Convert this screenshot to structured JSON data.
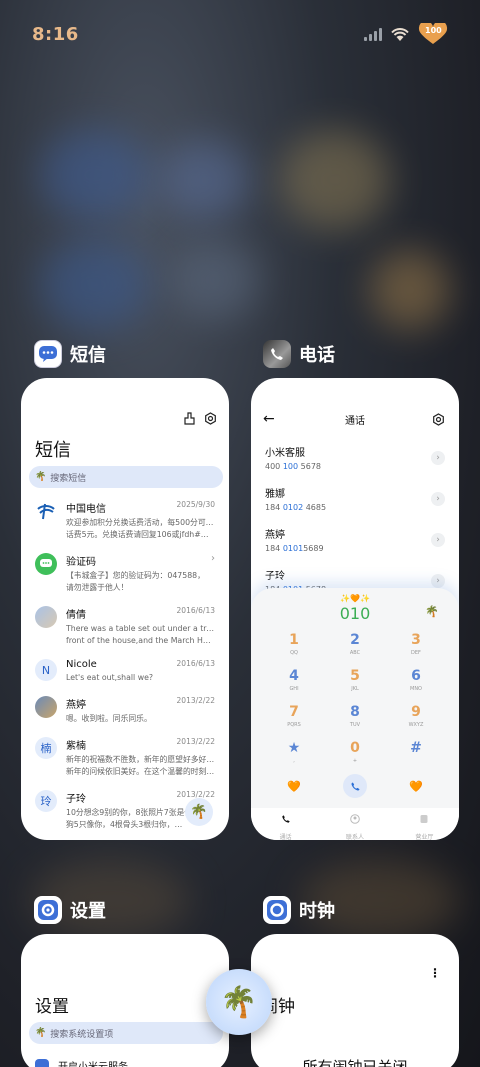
{
  "status_bar": {
    "time": "8:16",
    "battery": "100"
  },
  "colors": {
    "accent": "#2b6fd6",
    "digit_orange": "#e8a45a",
    "digit_blue": "#5b86d4",
    "search_bg": "#dfe8f9"
  },
  "sms_app": {
    "title": "短信",
    "screen_title": "短信",
    "search_placeholder": "搜索短信",
    "messages": [
      {
        "name": "中国电信",
        "date": "2025/9/30",
        "line1": "欢迎参加积分兑换话费活动，每500分可兑换",
        "line2": "话费5元。兑换话费请回复106或jfdh#话费…"
      },
      {
        "name": "验证码",
        "date": "",
        "line1": "【韦城盒子】您的验证码为：047588，",
        "line2": "请勿泄露于他人！"
      },
      {
        "name": "倩倩",
        "date": "2016/6/13",
        "line1": "There was a table set out under a tree in",
        "line2": "front of the house,and the March Hare an…"
      },
      {
        "name": "Nicole",
        "date": "2016/6/13",
        "line1": "Let's eat out,shall we?",
        "line2": ""
      },
      {
        "name": "燕婷",
        "date": "2013/2/22",
        "line1": "嗯。收到啦。同乐同乐。",
        "line2": ""
      },
      {
        "name": "紫楠",
        "date": "2013/2/22",
        "line1": "新年的祝福数不胜数，新年的愿望好多好多，",
        "line2": "新年的问候依旧美好。在这个温馨的时刻，…"
      },
      {
        "name": "子玲",
        "date": "2013/2/22",
        "line1": "10分想念9别的你，8张照片7张是你，6只小",
        "line2": "狗5只像你，4根骨头3根归你，2爪着地1只…"
      }
    ],
    "avatar_letters": {
      "nicole": "N",
      "zinan": "楠",
      "ziling": "玲"
    }
  },
  "phone_app": {
    "title": "电话",
    "screen_title": "通话",
    "contacts": [
      {
        "name": "小米客服",
        "num_a": "400 ",
        "num_b": "100",
        "num_c": " 5678"
      },
      {
        "name": "雅娜",
        "num_a": "184 ",
        "num_b": "0102",
        "num_c": " 4685"
      },
      {
        "name": "燕婷",
        "num_a": "184 ",
        "num_b": "0101",
        "num_c": "5689"
      },
      {
        "name": "子玲",
        "num_a": "184 ",
        "num_b": "0101",
        "num_c": " 5678"
      }
    ],
    "dialed": "010",
    "keys": [
      {
        "d": "1",
        "l": "QQ"
      },
      {
        "d": "2",
        "l": "ABC"
      },
      {
        "d": "3",
        "l": "DEF"
      },
      {
        "d": "4",
        "l": "GHI"
      },
      {
        "d": "5",
        "l": "JKL"
      },
      {
        "d": "6",
        "l": "MNO"
      },
      {
        "d": "7",
        "l": "PQRS"
      },
      {
        "d": "8",
        "l": "TUV"
      },
      {
        "d": "9",
        "l": "WXYZ"
      },
      {
        "d": "★",
        "l": ","
      },
      {
        "d": "0",
        "l": "+"
      },
      {
        "d": "#",
        "l": ""
      }
    ],
    "tabs": [
      "通话",
      "联系人",
      "营业厅"
    ]
  },
  "settings_app": {
    "title": "设置",
    "screen_title": "设置",
    "search_placeholder": "搜索系统设置项",
    "first_item": "开启小米云服务"
  },
  "clock_app": {
    "title": "时钟",
    "screen_title": "闹钟",
    "status": "所有闹钟已关闭"
  }
}
